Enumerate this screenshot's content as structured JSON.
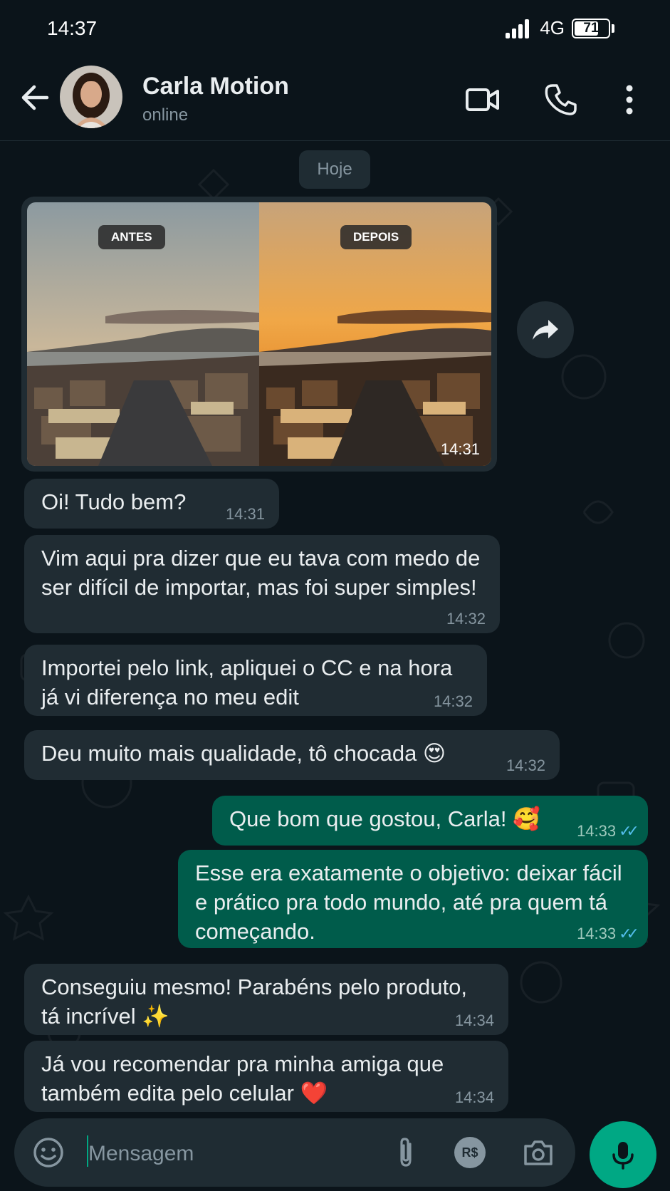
{
  "status_bar": {
    "time": "14:37",
    "network": "4G",
    "battery": "71",
    "battery_level": 0.71
  },
  "header": {
    "contact_name": "Carla Motion",
    "contact_status": "online",
    "icons": [
      "arrow-left-icon",
      "video-camera-icon",
      "phone-icon",
      "more-vertical-icon"
    ]
  },
  "chat": {
    "date_chip": "Hoje",
    "media_message": {
      "label_before": "ANTES",
      "label_after": "DEPOIS",
      "time": "14:31"
    },
    "messages": [
      {
        "direction": "in",
        "text": "Oi! Tudo bem?",
        "time": "14:31"
      },
      {
        "direction": "in",
        "text": "Vim aqui pra dizer que eu tava com medo de ser difícil de importar, mas foi super simples!",
        "time": "14:32"
      },
      {
        "direction": "in",
        "text": "Importei pelo link, apliquei o CC e na hora já vi diferença no meu edit",
        "time": "14:32"
      },
      {
        "direction": "in",
        "text": "Deu muito mais qualidade, tô chocada 😍",
        "time": "14:32"
      },
      {
        "direction": "out",
        "text": "Que bom que gostou, Carla! 🥰",
        "time": "14:33",
        "read_receipt": "✓✓"
      },
      {
        "direction": "out",
        "text": "Esse era exatamente o objetivo: deixar fácil e prático pra todo mundo, até pra quem tá começando.",
        "time": "14:33",
        "read_receipt": "✓✓"
      },
      {
        "direction": "in",
        "text": "Conseguiu mesmo! Parabéns pelo produto, tá incrível ✨",
        "time": "14:34"
      },
      {
        "direction": "in",
        "text": "Já vou recomendar pra minha amiga que também edita pelo celular ❤️",
        "time": "14:34"
      }
    ]
  },
  "composer": {
    "placeholder": "Mensagem",
    "value": "",
    "icons": [
      "emoji-icon",
      "paperclip-icon",
      "pix-payment-icon",
      "camera-icon",
      "microphone-icon"
    ],
    "payment_label": "R$"
  },
  "colors": {
    "background": "#0b141a",
    "incoming_bubble": "#202c33",
    "outgoing_bubble": "#005c4b",
    "accent": "#00a884",
    "read_tick": "#53bdeb"
  }
}
